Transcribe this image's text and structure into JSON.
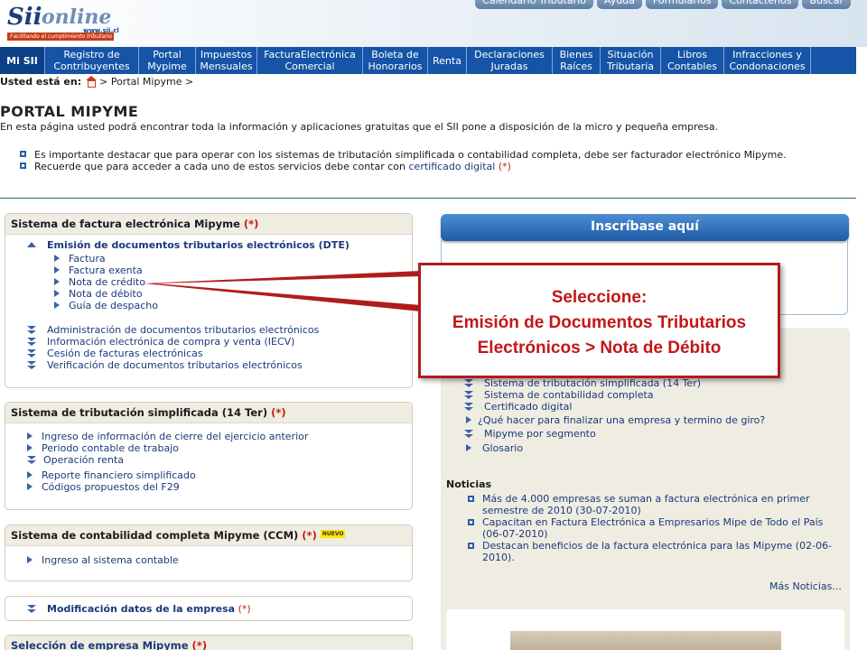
{
  "header": {
    "logo": {
      "brand": "Sii",
      "sub": "online",
      "site": "www.sii.cl",
      "tagline": "Facilitando el cumplimiento tributario"
    },
    "top_links": [
      "Calendario Tributario",
      "Ayuda",
      "Formularios",
      "Contáctenos",
      "Buscar"
    ]
  },
  "nav": [
    {
      "label": "Mi SII",
      "w": 50
    },
    {
      "label": "Registro de\nContribuyentes",
      "w": 104
    },
    {
      "label": "Portal\nMypime",
      "w": 63
    },
    {
      "label": "Impuestos\nMensuales",
      "w": 68
    },
    {
      "label": "FacturaElectrónica\nComercial",
      "w": 117
    },
    {
      "label": "Boleta de\nHonorarios",
      "w": 72
    },
    {
      "label": "Renta",
      "w": 43
    },
    {
      "label": "Declaraciones\nJuradas",
      "w": 95
    },
    {
      "label": "Bienes\nRaíces",
      "w": 53
    },
    {
      "label": "Situación\nTributaria",
      "w": 67
    },
    {
      "label": "Libros\nContables",
      "w": 70
    },
    {
      "label": "Infracciones y\nCondonaciones",
      "w": 96
    }
  ],
  "breadcrumb": {
    "prefix": "Usted está en:",
    "path": " > Portal Mipyme >"
  },
  "page": {
    "title": "PORTAL MIPYME",
    "intro": "En esta página usted podrá encontrar toda la información y aplicaciones gratuitas que el SII pone a disposición de la micro y pequeña empresa.",
    "note1": "Es importante destacar que para operar con los sistemas de tributación simplificada o contabilidad completa, debe ser facturador electrónico Mipyme.",
    "note2_text": "Recuerde que para acceder a cada uno de estos servicios debe contar con ",
    "note2_link": "certificado digital",
    "asterisk": "(*)"
  },
  "box1": {
    "title": "Sistema de factura electrónica Mipyme",
    "expanded": "Emisión de documentos tributarios electrónicos (DTE)",
    "sub_items": [
      "Factura",
      "Factura exenta",
      "Nota de crédito",
      "Nota de débito",
      "Guía de despacho"
    ],
    "items": [
      "Administración de documentos tributarios electrónicos",
      "Información electrónica de compra y venta (IECV)",
      "Cesión de facturas electrónicas",
      "Verificación de documentos tributarios electrónicos"
    ]
  },
  "box2": {
    "title": "Sistema de tributación simplificada (14 Ter)",
    "items": [
      "Ingreso de información de cierre del ejercicio anterior",
      "Periodo contable de trabajo",
      "Operación renta",
      "Reporte financiero simplificado",
      "Códigos propuestos del F29"
    ]
  },
  "box3": {
    "title": "Sistema de contabilidad completa Mipyme (CCM)",
    "badge": "NUEVO",
    "items": [
      "Ingreso al sistema  contable"
    ]
  },
  "box4": {
    "title": "Modificación datos de la empresa"
  },
  "box5": {
    "title": "Selección de empresa Mipyme"
  },
  "right": {
    "inscribase": "Inscríbase aquí",
    "links": [
      "Sistema de tributación simplificada (14 Ter)",
      "Sistema de contabilidad completa",
      "Certificado digital",
      "¿Qué hacer para finalizar una empresa y termino de giro?",
      "Mipyme por segmento",
      "Glosario"
    ],
    "noticias_title": "Noticias",
    "news": [
      "Más de 4.000 empresas se suman a factura electrónica en primer semestre de 2010 (30-07-2010)",
      "Capacitan en Factura Electrónica a Empresarios Mipe de Todo el País (06-07-2010)",
      "Destacan beneficios de la factura electrónica para las Mipyme (02-06-2010)."
    ],
    "mas_noticias": "Más Noticias..."
  },
  "callout": {
    "line1": "Seleccione:",
    "line2": "Emisión de Documentos Tributarios",
    "line3": "Electrónicos > Nota de Débito"
  },
  "colors": {
    "nav": "#1554a6",
    "callout": "#b01c1c",
    "link": "#1a3a7a"
  }
}
